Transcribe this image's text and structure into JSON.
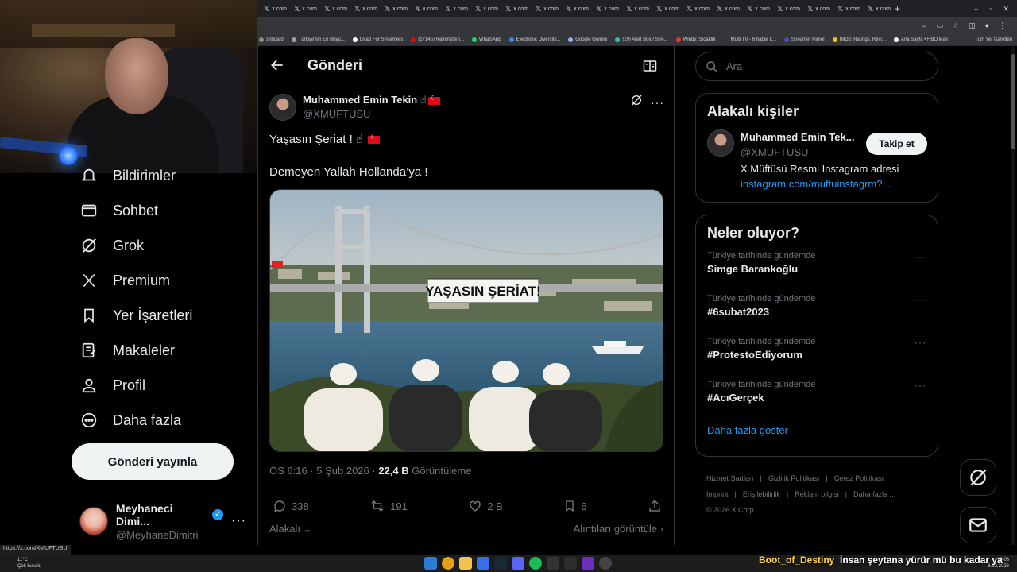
{
  "browser": {
    "tab_label": "x.com",
    "tab_count": 21,
    "bookmarks": [
      {
        "label": "shboard",
        "color": "#888888"
      },
      {
        "label": "Türkiye'nin En Büyü...",
        "color": "#9aa0a6"
      },
      {
        "label": "Livad For Streamers",
        "color": "#ffffff"
      },
      {
        "label": "(17145) Rammstein...",
        "color": "#ff0000"
      },
      {
        "label": "WhatsApp",
        "color": "#25d366"
      },
      {
        "label": "Electronic Diversity...",
        "color": "#4285f4"
      },
      {
        "label": "Google Gemini",
        "color": "#8ab4f8"
      },
      {
        "label": "(19) Alert Box / Stre...",
        "color": "#31c3a2"
      },
      {
        "label": "Windy: Sıcaklık",
        "color": "#e53935"
      },
      {
        "label": "Multi TV - 6 haber k...",
        "color": "#333333"
      },
      {
        "label": "Streamer Panel",
        "color": "#3f51b5"
      },
      {
        "label": "IMDb: Ratings, Revi...",
        "color": "#f5c518"
      },
      {
        "label": "Ana Sayfa • HBO Max",
        "color": "#ffffff"
      }
    ],
    "bookmarks_all": "Tüm Yer İşaretleri"
  },
  "nav": {
    "items": [
      {
        "label": "Bildirimler",
        "icon": "bell-icon"
      },
      {
        "label": "Sohbet",
        "icon": "mail-icon"
      },
      {
        "label": "Grok",
        "icon": "grok-icon"
      },
      {
        "label": "Premium",
        "icon": "x-logo-icon"
      },
      {
        "label": "Yer İşaretleri",
        "icon": "bookmark-icon"
      },
      {
        "label": "Makaleler",
        "icon": "article-icon"
      },
      {
        "label": "Profil",
        "icon": "person-icon"
      },
      {
        "label": "Daha fazla",
        "icon": "more-circle-icon"
      }
    ],
    "post_button": "Gönderi yayınla",
    "account": {
      "name": "Meyhaneci Dimi...",
      "handle": "@MeyhaneDimitri"
    }
  },
  "main": {
    "header_title": "Gönderi",
    "author_name": "Muhammed Emin Tekin",
    "author_emoji": "☝",
    "author_handle": "@XMUFTUSU",
    "text_line1": "Yaşasın Şeriat ! ☝",
    "text_line2": "Demeyen Yallah Hollanda’ya !",
    "banner_text": "YAŞASIN ŞERİAT!",
    "meta_time": "ÖS 6:16 · 5 Şub 2026 · ",
    "meta_views": "22,4 B",
    "meta_views_label": " Görüntüleme",
    "actions": {
      "replies": "338",
      "reposts": "191",
      "likes": "2 B",
      "bookmarks": "6"
    },
    "relevant_label": "Alakalı",
    "quotes_label": "Alıntıları görüntüle"
  },
  "right": {
    "search_placeholder": "Ara",
    "relevant_title": "Alakalı kişiler",
    "relevant_person": {
      "name": "Muhammed Emin Tek...",
      "handle": "@XMUFTUSU",
      "follow_label": "Takip et",
      "bio": "X Müftüsü Resmi Instagram adresi",
      "link": "instagram.com/muftuinstagrm?..."
    },
    "trends_title": "Neler oluyor?",
    "trends": [
      {
        "context": "Türkiye tarihinde gündemde",
        "topic": "Simge Barankoğlu"
      },
      {
        "context": "Türkiye tarihinde gündemde",
        "topic": "#6subat2023"
      },
      {
        "context": "Türkiye tarihinde gündemde",
        "topic": "#ProtestoEdiyorum"
      },
      {
        "context": "Türkiye tarihinde gündemde",
        "topic": "#AcıGerçek"
      }
    ],
    "show_more": "Daha fazla göster",
    "footer_links": [
      "Hizmet Şartları",
      "Gizlilik Politikası",
      "Çerez Politikası",
      "Imprint",
      "Erişilebilirlik",
      "Reklam bilgisi",
      "Daha fazla ..."
    ],
    "copyright": "© 2026 X Corp."
  },
  "status": {
    "hover_url": "https://x.com/XMUFTUSU",
    "weather_temp": "11°C",
    "weather_desc": "Çok bulutlu",
    "time": "10:08",
    "date": "6.02.2026"
  },
  "chat": {
    "user": "Boot_of_Destiny",
    "message": "İnsan şeytana yürür mü bu kadar ya"
  },
  "colors": {
    "accent": "#1d9bf0",
    "border": "#2f3336",
    "muted": "#71767b"
  }
}
